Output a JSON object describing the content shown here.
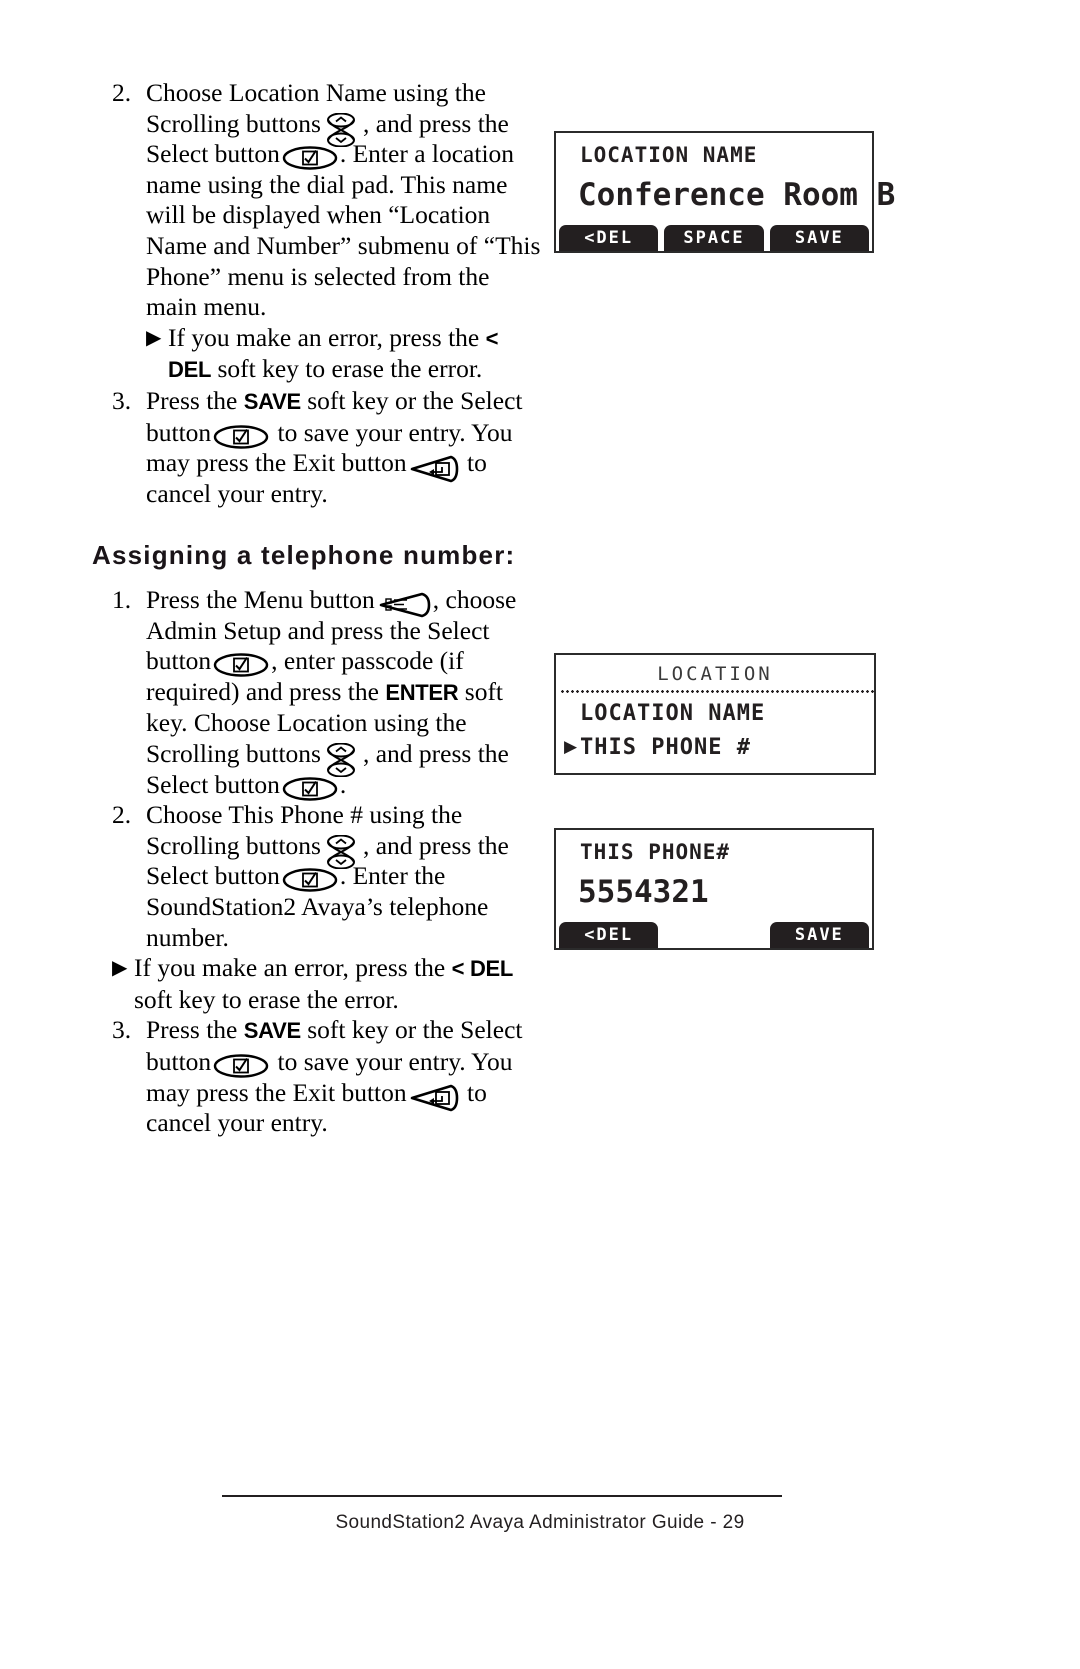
{
  "page": {
    "footer": "SoundStation2 Avaya Administrator Guide - 29"
  },
  "section_one": {
    "step2": {
      "number": "2.",
      "t1": "Choose Location Name using the Scrolling buttons",
      "t2": ", and press the Select button",
      "t3": ".  Enter a location name using the dial pad. This name will be displayed when “Location Name and Number” submenu of “This Phone” menu is selected from the main menu."
    },
    "bullet": {
      "marker": "▶",
      "t1": "If you make an error, press the",
      "softkey": "< DEL",
      "t2": "soft key to erase the error."
    },
    "step3": {
      "number": "3.",
      "t1": "Press the",
      "softkey": "SAVE",
      "t2": "soft key or the Select button",
      "t3": "to save your entry.  You may press the Exit button",
      "t4": "to cancel your entry."
    }
  },
  "heading": {
    "text": "Assigning a telephone number:"
  },
  "section_two": {
    "step1": {
      "number": "1.",
      "t1": "Press the Menu button",
      "t2": ", choose Admin Setup and press the Select button",
      "t3": ", enter passcode (if required) and press the",
      "softkey": "ENTER",
      "t4": "soft key.  Choose Location using the Scrolling buttons",
      "t5": ", and press the Select button",
      "t6": "."
    },
    "step2": {
      "number": "2.",
      "t1": "Choose This Phone # using the Scrolling buttons",
      "t2": ", and press the Select button",
      "t3": ".  Enter the SoundStation2 Avaya’s telephone number."
    },
    "bullet": {
      "marker": "▶",
      "t1": "If you make an error, press the",
      "softkey": "< DEL",
      "t2": "soft key to erase the error."
    },
    "step3": {
      "number": "3.",
      "t1": "Press the",
      "softkey": "SAVE",
      "t2": "soft key or the Select button",
      "t3": "to save your entry.  You may press the Exit button",
      "t4": "to cancel your entry."
    }
  },
  "lcd_location_name": {
    "title": "LOCATION NAME",
    "value": "Conference Room B",
    "softkeys": [
      "<DEL",
      "SPACE",
      "SAVE"
    ]
  },
  "lcd_location_menu": {
    "title": "LOCATION",
    "items": [
      {
        "label": "LOCATION NAME",
        "selected": false
      },
      {
        "label": "THIS PHONE #",
        "selected": true
      }
    ],
    "pointer": "▶"
  },
  "lcd_this_phone": {
    "title": "THIS PHONE#",
    "value": "5554321",
    "softkeys": [
      "<DEL",
      "SAVE"
    ]
  },
  "colors": {
    "ink": "#231f20",
    "lcd_bg": "#ffffff",
    "softkey_bg": "#231f20",
    "softkey_text": "#ffffff"
  }
}
